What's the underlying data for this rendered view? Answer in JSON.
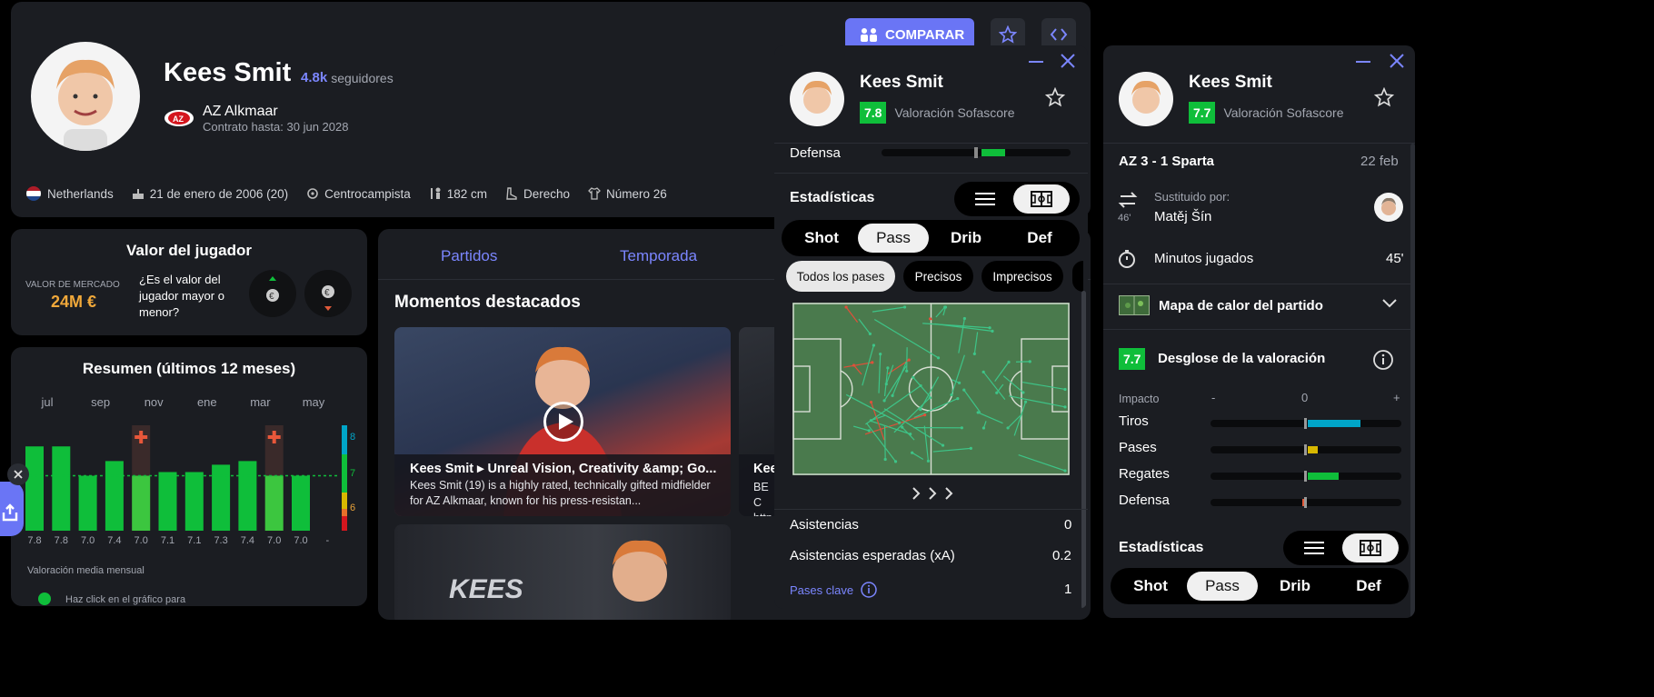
{
  "player": {
    "name": "Kees Smit",
    "followers_count": "4.8k",
    "followers_label": "seguidores",
    "club": "AZ Alkmaar",
    "contract": "Contrato hasta: 30 jun 2028",
    "compare_label": "COMPARAR",
    "info": {
      "nationality": "Netherlands",
      "birth": "21 de enero de 2006 (20)",
      "position": "Centrocampista",
      "height": "182 cm",
      "foot": "Derecho",
      "number": "Número 26"
    }
  },
  "value": {
    "title": "Valor del jugador",
    "market_label": "VALOR DE MERCADO",
    "market_value": "24M €",
    "question": "¿Es el valor del jugador mayor o menor?"
  },
  "summary": {
    "title": "Resumen (últimos 12 meses)",
    "months": [
      "jul",
      "sep",
      "nov",
      "ene",
      "mar",
      "may"
    ],
    "scale": [
      "8",
      "7",
      "6"
    ],
    "footer": "Valoración media mensual",
    "hint": "Haz click en el gráfico para",
    "colors": {
      "bar": "#0fbe3a",
      "bar_light": "#3cc63f",
      "injury": "#e8573a",
      "accent": "#7b86ff"
    }
  },
  "chart_data": {
    "type": "bar",
    "title": "Resumen (últimos 12 meses)",
    "categories": [
      "jul",
      "",
      "sep",
      "",
      "nov",
      "",
      "ene",
      "",
      "mar",
      "",
      "may",
      ""
    ],
    "values": [
      7.8,
      7.8,
      7.0,
      7.4,
      7.0,
      7.1,
      7.1,
      7.3,
      7.4,
      7.0,
      7.0,
      null
    ],
    "value_labels": [
      "7.8",
      "7.8",
      "7.0",
      "7.4",
      "7.0",
      "7.1",
      "7.1",
      "7.3",
      "7.4",
      "7.0",
      "7.0",
      "-"
    ],
    "injury_months": [
      4,
      9
    ],
    "reference_line": 7,
    "ylim": [
      5.5,
      8.5
    ]
  },
  "tabs": [
    "Partidos",
    "Temporada"
  ],
  "highlights": {
    "title": "Momentos destacados",
    "video1_title": "Kees Smit ▸ Unreal Vision, Creativity &amp; Go...",
    "video1_desc": "Kees Smit (19) is a highly rated, technically gifted midfielder for AZ Alkmaar, known for his press-resistan...",
    "video2_title": "Kee",
    "video2_desc": "BE C http",
    "video3_text": "KEES"
  },
  "popup1": {
    "name": "Kees Smit",
    "rating": "7.8",
    "rating_label": "Valoración Sofascore",
    "defense_label": "Defensa",
    "stats_title": "Estadísticas",
    "tabs": [
      "Shot",
      "Pass",
      "Drib",
      "Def"
    ],
    "filters": [
      "Todos los pases",
      "Precisos",
      "Imprecisos"
    ],
    "stats": [
      {
        "label": "Asistencias",
        "value": "0"
      },
      {
        "label": "Asistencias esperadas (xA)",
        "value": "0.2"
      }
    ],
    "key_passes_label": "Pases clave",
    "key_passes_value": "1"
  },
  "popup2": {
    "name": "Kees Smit",
    "rating": "7.7",
    "rating_label": "Valoración Sofascore",
    "match": "AZ 3 - 1 Sparta",
    "date": "22 feb",
    "sub_label": "Sustituido por:",
    "sub_minute": "46'",
    "sub_player": "Matěj Šín",
    "minutes_label": "Minutos jugados",
    "minutes_value": "45'",
    "heatmap_label": "Mapa de calor del partido",
    "breakdown_label": "Desglose de la valoración",
    "impact_label": "Impacto",
    "impact_minus": "-",
    "impact_zero": "0",
    "impact_plus": "+",
    "breakdown": [
      {
        "label": "Tiros",
        "value": 0.55,
        "color": "#00a5c8"
      },
      {
        "label": "Pases",
        "value": 0.1,
        "color": "#d8b800"
      },
      {
        "label": "Regates",
        "value": 0.32,
        "color": "#0fbe3a"
      },
      {
        "label": "Defensa",
        "value": -0.02,
        "color": "#e05a3a"
      }
    ],
    "stats_title": "Estadísticas",
    "tabs": [
      "Shot",
      "Pass",
      "Drib",
      "Def"
    ]
  }
}
